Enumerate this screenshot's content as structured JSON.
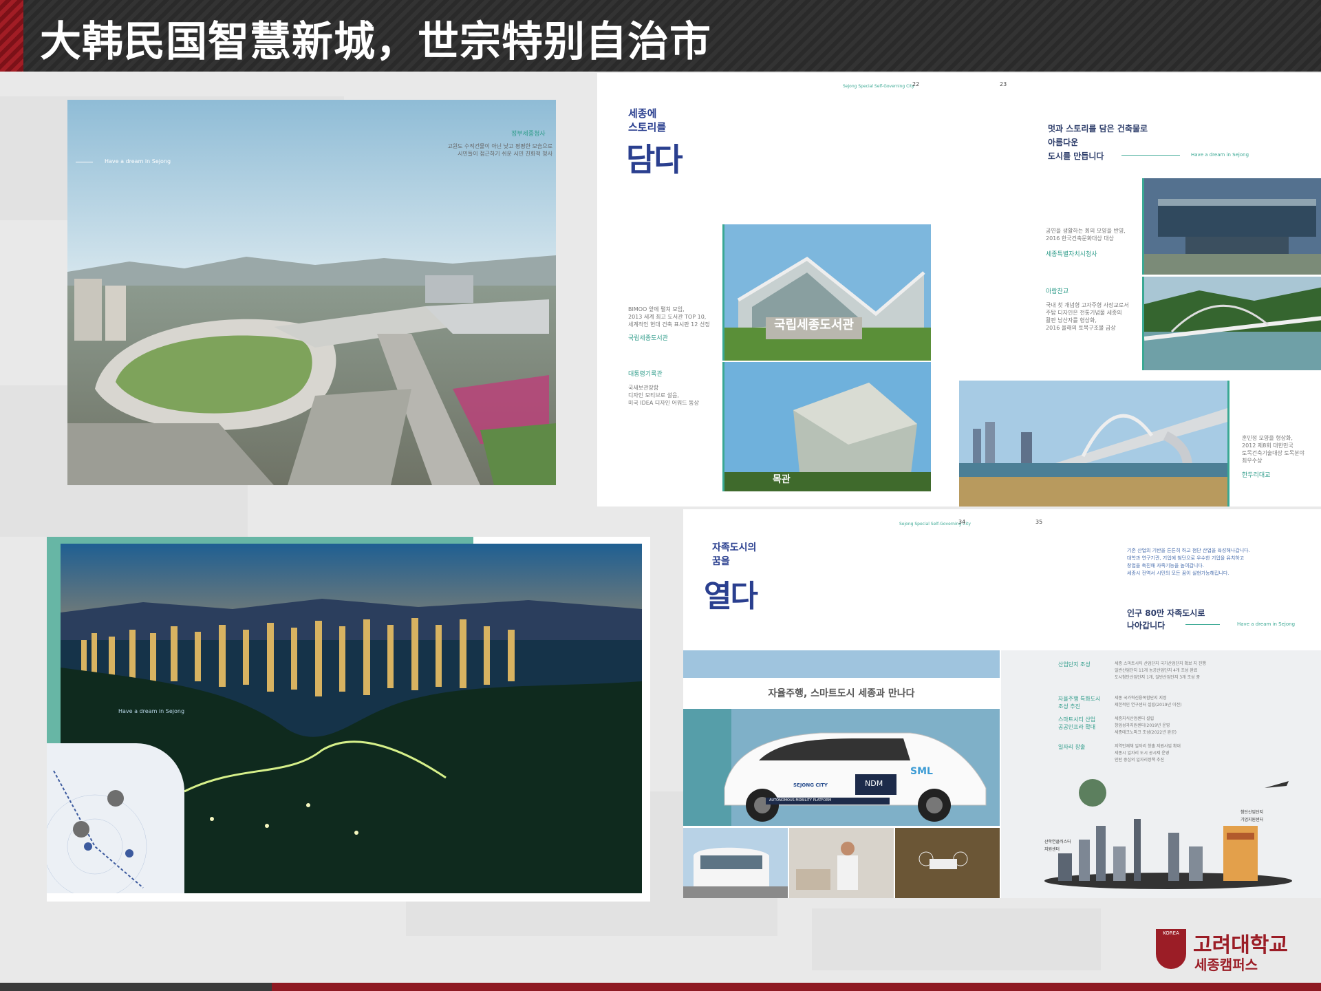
{
  "slide": {
    "title": "大韩民国智慧新城，世宗特别自治市"
  },
  "panel_a": {
    "tagline": "Have a dream in Sejong",
    "heading": "정부세종청사",
    "caption": "고원도 수직건물이 아닌 낮고 평평한 모습으로\n시민들이 접근하기 쉬운 시민 친화적 청사"
  },
  "panel_b": {
    "header_small": "Sejong Special Self-Governing City",
    "page_left": "22",
    "page_right": "23",
    "headline_l1": "세종에",
    "headline_l2": "스토리를",
    "headline_big": "담다",
    "right_title_l1": "멋과 스토리를 담은 건축물로",
    "right_title_l2": "아름다운",
    "right_title_l3": "도시를 만듭니다",
    "tagline": "Have a dream in Sejong",
    "sign_text": "국립세종도서관",
    "sign_text_2": "목관",
    "left_caption_1": "BIMOO 앞에 펼쳐 모임,\n2013 세계 최고 도서관 TOP 10,\n세계적인 현대 건축 표시판 12 선정",
    "left_heading_1": "국립세종도서관",
    "left_heading_2": "대통령기록관",
    "left_caption_2": "국새보관장함\n디자인 모티브로 설음,\n미국 IDEA 디자인 어워드 동상",
    "right_caption_1": "공연을 생활하는 회의 모양을 반영,\n2016 한국건축문화대상 대상",
    "right_heading_1": "세종특별자치시청사",
    "right_heading_2": "아람찬교",
    "right_caption_2": "국내 첫 개념형 고자주형 사장교로서\n주탑 디자인은 전통기념물 세종의\n활판 남산자를 형상화,\n2016 올해의 토목구조물 금상",
    "right_caption_3": "훈민정 모양을 형상화,\n2012 제8회 대한민국\n토목건축기술대상 토목분야\n최우수상",
    "right_heading_3": "한두리대교"
  },
  "panel_c": {
    "tagline": "Have a dream in Sejong"
  },
  "panel_d": {
    "header_small": "Sejong Special Self-Governing City",
    "page_left": "34",
    "page_right": "35",
    "headline_l1": "자족도시의",
    "headline_l2": "꿈을",
    "headline_big": "열다",
    "intro": "기존 산업의 기반을 튼튼히 하고 첨단 산업을 육성해나갑니다.\n대학과 연구기관, 기업에 첨단으로 우수한 기업을 유치하고\n창업을 촉진해 자족기능을 높여갑니다.\n세종시 전역서 시민의 모든 꿈이 실현가능해집니다.",
    "title_l1": "인구 80만 자족도시로",
    "title_l2": "나아갑니다",
    "tagline": "Have a dream in Sejong",
    "banner": "자율주행, 스마트도시 세종과 만나다",
    "car_brand": "SEJONG CITY",
    "car_ndm": "NDM",
    "car_sml": "SML",
    "car_strip": "AUTONOMOUS MOBILITY PLATFORM",
    "list": [
      {
        "heading": "산업단지 조성",
        "text": "세종 스마트시티 산업단지 국가산업단지 확보 지 진행\n일반산업단지 11개 농공산업단지 4개 조성 완료\n도시첨단산업단지 1개, 일반산업단지 3개 조성 중"
      },
      {
        "heading": "자율주행 특화도시\n조성 추진",
        "text": "세종 국가혁신융복합단지 지정\n제한적인 연구센터 설립(2019년 이전)"
      },
      {
        "heading": "스마트시티 산업\n공공인프라 확대",
        "text": "세종지식산업센터 설립\n창업성과지원센터(2019년 운영\n세종테크노파크 조성(2022년 완공)"
      },
      {
        "heading": "일자리 창출",
        "text": "지역인재채 일자리 창출 지원사업 확대\n세종시 일자리 도시 공시제 운영\n인턴 중심의 일자리정책 추진"
      }
    ],
    "label_left": "산학연클러스터\n지원센터",
    "label_right": "첨단산업단지\n기업지원센터"
  },
  "logo": {
    "badge": "KOREA",
    "name_kr": "고려대학교",
    "campus_kr": "세종캠퍼스"
  }
}
